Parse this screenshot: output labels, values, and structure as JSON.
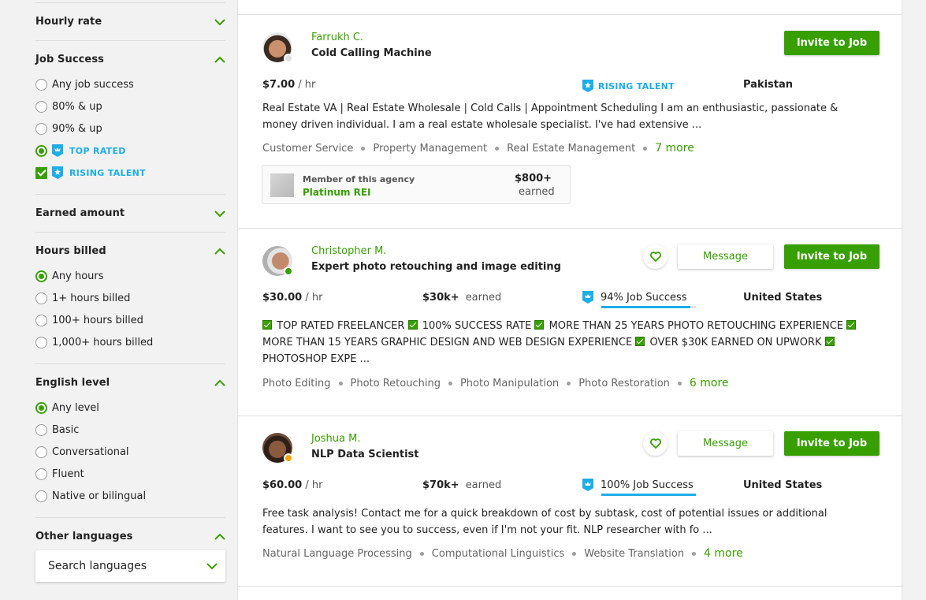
{
  "sidebar": {
    "hourly_rate": {
      "title": "Hourly rate",
      "expanded": false
    },
    "job_success": {
      "title": "Job Success",
      "expanded": true,
      "options": [
        {
          "label": "Any job success",
          "type": "radio",
          "selected": false
        },
        {
          "label": "80% & up",
          "type": "radio",
          "selected": false
        },
        {
          "label": "90% & up",
          "type": "radio",
          "selected": false
        },
        {
          "label": "TOP RATED",
          "type": "radio",
          "selected": true,
          "badge": "top-rated"
        },
        {
          "label": "RISING TALENT",
          "type": "checkbox",
          "selected": true,
          "badge": "rising-talent"
        }
      ]
    },
    "earned_amount": {
      "title": "Earned amount",
      "expanded": false
    },
    "hours_billed": {
      "title": "Hours billed",
      "expanded": true,
      "options": [
        {
          "label": "Any hours",
          "selected": true
        },
        {
          "label": "1+ hours billed",
          "selected": false
        },
        {
          "label": "100+ hours billed",
          "selected": false
        },
        {
          "label": "1,000+ hours billed",
          "selected": false
        }
      ]
    },
    "english_level": {
      "title": "English level",
      "expanded": true,
      "options": [
        {
          "label": "Any level",
          "selected": true
        },
        {
          "label": "Basic",
          "selected": false
        },
        {
          "label": "Conversational",
          "selected": false
        },
        {
          "label": "Fluent",
          "selected": false
        },
        {
          "label": "Native or bilingual",
          "selected": false
        }
      ]
    },
    "other_languages": {
      "title": "Other languages",
      "expanded": true,
      "search_placeholder": "Search languages"
    }
  },
  "colors": {
    "accent_green": "#37a000",
    "badge_blue": "#1daee8",
    "status_offline": "#e0e0e0",
    "status_online": "#37a000",
    "status_away": "#f0a40f"
  },
  "freelancers": [
    {
      "name": "Farrukh C.",
      "title": "Cold Calling Machine",
      "status": "offline",
      "rate": "$7.00",
      "rate_unit": "/ hr",
      "badge": "RISING TALENT",
      "country": "Pakistan",
      "description": "Real Estate VA | Real Estate Wholesale | Cold Calls | Appointment Scheduling I am an enthusiastic, passionate & money driven individual. I am a real estate wholesale specialist. I've had extensive ...",
      "skills": [
        "Customer Service",
        "Property Management",
        "Real Estate Management"
      ],
      "more_skills": "7 more",
      "agency": {
        "label": "Member of this agency",
        "name": "Platinum REI",
        "amount": "$800+",
        "amount_label": "earned"
      },
      "invite_label": "Invite to Job"
    },
    {
      "name": "Christopher M.",
      "title": "Expert photo retouching and image editing",
      "status": "online",
      "rate": "$30.00",
      "rate_unit": "/ hr",
      "earned": "$30k+",
      "earned_label": "earned",
      "job_success": "94% Job Success",
      "job_success_value": 94,
      "country": "United States",
      "description_items": [
        "TOP RATED FREELANCER",
        "100% SUCCESS RATE",
        "MORE THAN 25 YEARS PHOTO RETOUCHING EXPERIENCE",
        "MORE THAN 15 YEARS GRAPHIC DESIGN AND WEB DESIGN EXPERIENCE",
        "OVER $30K EARNED ON UPWORK",
        "PHOTOSHOP EXPE ..."
      ],
      "skills": [
        "Photo Editing",
        "Photo Retouching",
        "Photo Manipulation",
        "Photo Restoration"
      ],
      "more_skills": "6 more",
      "message_label": "Message",
      "invite_label": "Invite to Job"
    },
    {
      "name": "Joshua M.",
      "title": "NLP Data Scientist",
      "status": "away",
      "rate": "$60.00",
      "rate_unit": "/ hr",
      "earned": "$70k+",
      "earned_label": "earned",
      "job_success": "100% Job Success",
      "job_success_value": 100,
      "country": "United States",
      "description": "Free task analysis! Contact me for a quick breakdown of cost by subtask, cost of potential issues or additional features. I want to see you to success, even if I'm not your fit. NLP researcher with fo ...",
      "skills": [
        "Natural Language Processing",
        "Computational Linguistics",
        "Website Translation"
      ],
      "more_skills": "4 more",
      "message_label": "Message",
      "invite_label": "Invite to Job"
    }
  ]
}
